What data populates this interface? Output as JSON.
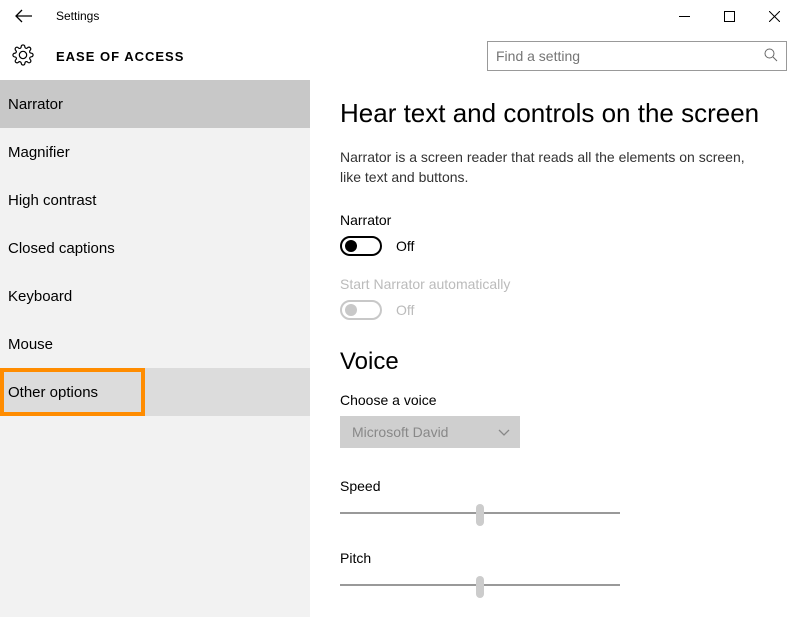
{
  "window": {
    "app_title": "Settings",
    "section_title": "EASE OF ACCESS"
  },
  "search": {
    "placeholder": "Find a setting"
  },
  "sidebar": {
    "items": [
      {
        "label": "Narrator",
        "selected": true
      },
      {
        "label": "Magnifier"
      },
      {
        "label": "High contrast"
      },
      {
        "label": "Closed captions"
      },
      {
        "label": "Keyboard"
      },
      {
        "label": "Mouse"
      },
      {
        "label": "Other options",
        "hover": true,
        "highlighted": true
      }
    ]
  },
  "content": {
    "heading": "Hear text and controls on the screen",
    "description": "Narrator is a screen reader that reads all the elements on screen, like text and buttons.",
    "narrator": {
      "label": "Narrator",
      "state": "Off"
    },
    "auto_start": {
      "label": "Start Narrator automatically",
      "state": "Off"
    },
    "voice": {
      "heading": "Voice",
      "choose_label": "Choose a voice",
      "selected": "Microsoft David",
      "speed_label": "Speed",
      "pitch_label": "Pitch"
    }
  }
}
